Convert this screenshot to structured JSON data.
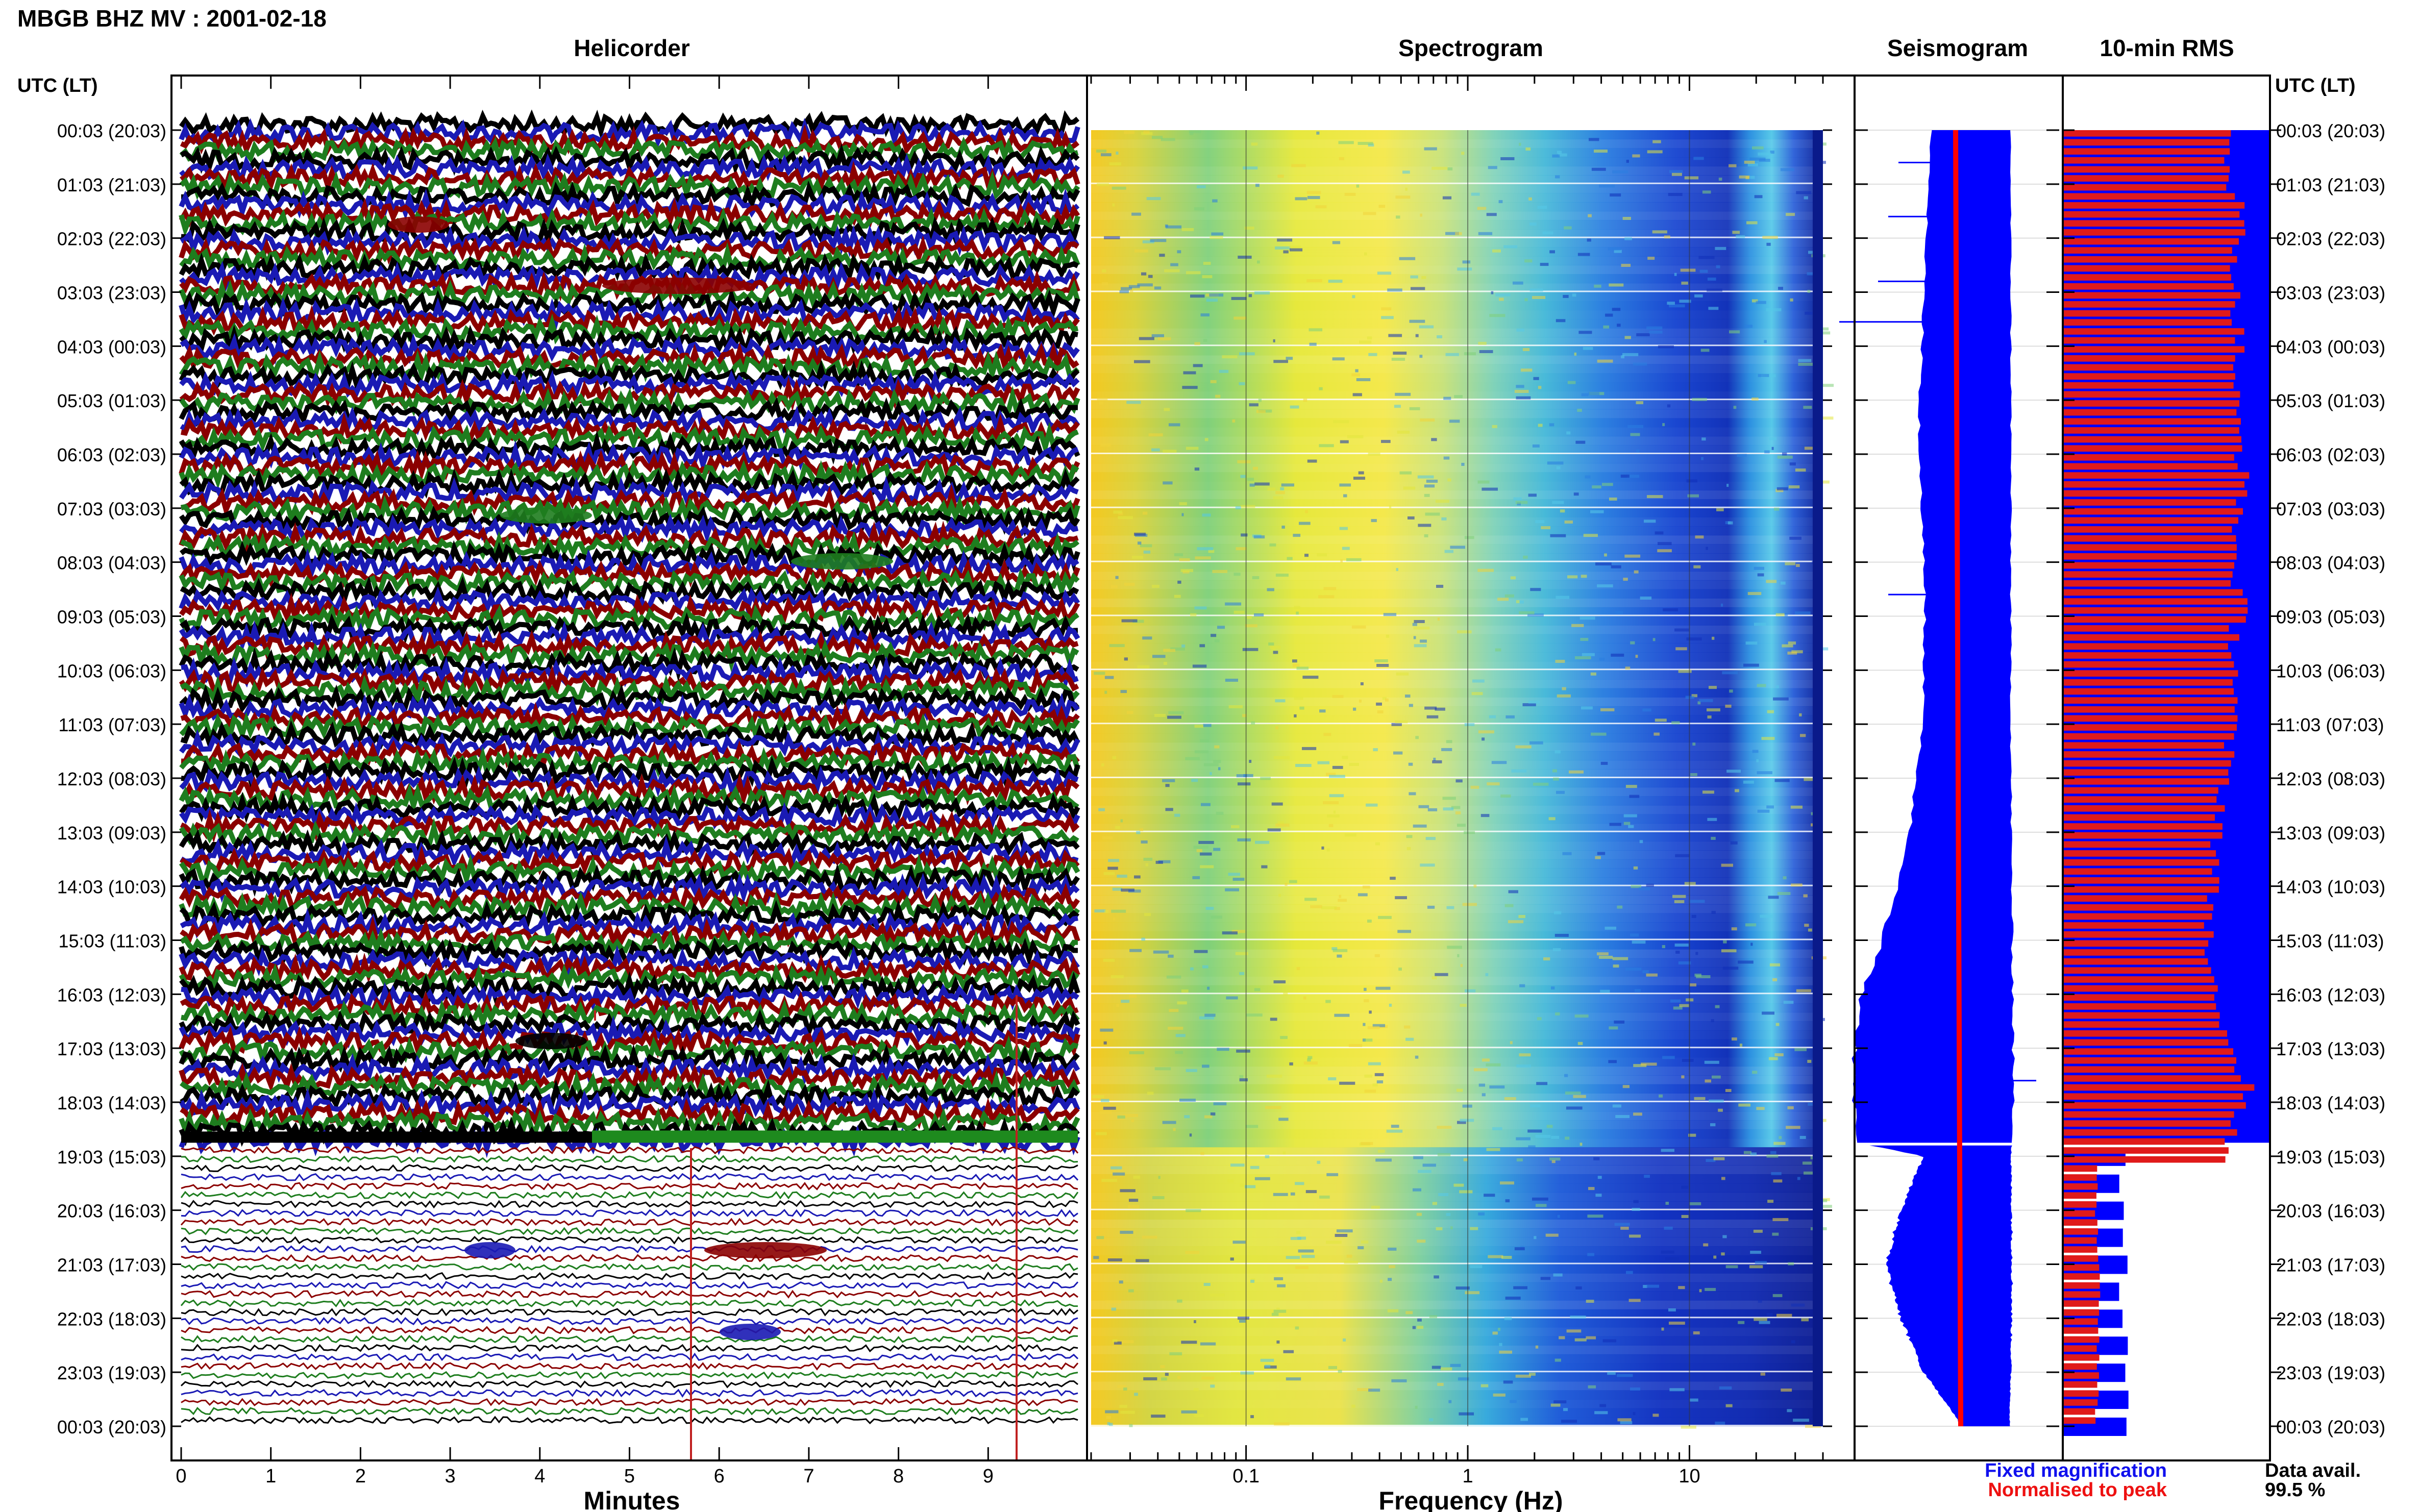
{
  "header": {
    "station_title": "MBGB BHZ MV : 2001-02-18"
  },
  "panels": {
    "helicorder": "Helicorder",
    "spectrogram": "Spectrogram",
    "seismogram": "Seismogram",
    "rms": "10-min RMS"
  },
  "axis": {
    "utc_label_left": "UTC (LT)",
    "utc_label_right": "UTC (LT)",
    "time_rows": [
      "00:03 (20:03)",
      "01:03 (21:03)",
      "02:03 (22:03)",
      "03:03 (23:03)",
      "04:03 (00:03)",
      "05:03 (01:03)",
      "06:03 (02:03)",
      "07:03 (03:03)",
      "08:03 (04:03)",
      "09:03 (05:03)",
      "10:03 (06:03)",
      "11:03 (07:03)",
      "12:03 (08:03)",
      "13:03 (09:03)",
      "14:03 (10:03)",
      "15:03 (11:03)",
      "16:03 (12:03)",
      "17:03 (13:03)",
      "18:03 (14:03)",
      "19:03 (15:03)",
      "20:03 (16:03)",
      "21:03 (17:03)",
      "22:03 (18:03)",
      "23:03 (19:03)",
      "00:03 (20:03)"
    ],
    "minutes_label": "Minutes",
    "minutes_ticks": [
      "0",
      "1",
      "2",
      "3",
      "4",
      "5",
      "6",
      "7",
      "8",
      "9"
    ],
    "frequency_label": "Frequency (Hz)",
    "frequency_ticks": [
      "0.1",
      "1",
      "10"
    ]
  },
  "legend": {
    "fixed": "Fixed magnification",
    "normalised": "Normalised to peak",
    "fixed_color": "#1010ee",
    "normalised_color": "#ee1111"
  },
  "availability": {
    "label": "Data avail.",
    "value": "99.5 %"
  },
  "colors": {
    "trace_black": "#000000",
    "trace_blue": "#1a1ab4",
    "trace_red": "#8b0000",
    "trace_green": "#1e7d1e",
    "seis_blue": "#0000ff",
    "seis_red": "#ff0000",
    "rms_red": "#e01a1a"
  },
  "chart_data": {
    "type": "heatmap",
    "title": "MBGB BHZ MV : 2001-02-18",
    "xlabel_helicorder": "Minutes",
    "xlim_minutes": [
      0,
      10
    ],
    "xlabel_spectrogram": "Frequency (Hz)",
    "xlim_frequency_hz": [
      0.02,
      40
    ],
    "x_scale_spectrogram": "log",
    "ylim_hours": [
      0,
      24
    ],
    "high_gain_until_hour": 18.75,
    "rms_normalised": [
      [
        0.0,
        0.8
      ],
      [
        0.5,
        0.82
      ],
      [
        1.0,
        0.85
      ],
      [
        1.5,
        0.86
      ],
      [
        2.0,
        0.84
      ],
      [
        2.5,
        0.83
      ],
      [
        3.0,
        0.84
      ],
      [
        3.5,
        0.85
      ],
      [
        4.0,
        0.84
      ],
      [
        4.5,
        0.83
      ],
      [
        5.0,
        0.84
      ],
      [
        5.5,
        0.86
      ],
      [
        6.0,
        0.87
      ],
      [
        6.5,
        0.86
      ],
      [
        7.0,
        0.84
      ],
      [
        7.5,
        0.83
      ],
      [
        8.0,
        0.84
      ],
      [
        8.5,
        0.86
      ],
      [
        9.0,
        0.83
      ],
      [
        9.5,
        0.84
      ],
      [
        10.0,
        0.83
      ],
      [
        10.5,
        0.82
      ],
      [
        11.0,
        0.8
      ],
      [
        11.5,
        0.79
      ],
      [
        12.0,
        0.77
      ],
      [
        12.5,
        0.76
      ],
      [
        13.0,
        0.74
      ],
      [
        13.5,
        0.73
      ],
      [
        14.0,
        0.72
      ],
      [
        14.5,
        0.71
      ],
      [
        15.0,
        0.7
      ],
      [
        15.5,
        0.72
      ],
      [
        16.0,
        0.74
      ],
      [
        16.5,
        0.81
      ],
      [
        17.0,
        0.86
      ],
      [
        17.5,
        0.9
      ],
      [
        18.0,
        0.84
      ],
      [
        18.5,
        0.8
      ],
      [
        19.0,
        0.17
      ],
      [
        19.5,
        0.16
      ],
      [
        20.0,
        0.17
      ],
      [
        20.5,
        0.17
      ],
      [
        21.0,
        0.18
      ],
      [
        21.5,
        0.17
      ],
      [
        22.0,
        0.17
      ],
      [
        22.5,
        0.17
      ],
      [
        23.0,
        0.17
      ],
      [
        23.5,
        0.16
      ],
      [
        24.0,
        0.16
      ]
    ],
    "seismogram_envelope_normalised": [
      [
        0.0,
        0.5
      ],
      [
        1.0,
        0.52
      ],
      [
        2.0,
        0.53
      ],
      [
        3.0,
        0.55
      ],
      [
        4.0,
        0.56
      ],
      [
        5.0,
        0.58
      ],
      [
        6.0,
        0.58
      ],
      [
        7.0,
        0.56
      ],
      [
        8.0,
        0.55
      ],
      [
        9.0,
        0.54
      ],
      [
        10.0,
        0.55
      ],
      [
        11.0,
        0.56
      ],
      [
        12.0,
        0.6
      ],
      [
        13.0,
        0.64
      ],
      [
        14.0,
        0.72
      ],
      [
        15.0,
        0.82
      ],
      [
        16.0,
        0.96
      ],
      [
        17.0,
        1.0
      ],
      [
        18.0,
        1.0
      ],
      [
        18.75,
        1.0
      ],
      [
        19.0,
        0.55
      ],
      [
        20.0,
        0.7
      ],
      [
        21.0,
        0.8
      ],
      [
        22.0,
        0.7
      ],
      [
        23.0,
        0.55
      ],
      [
        24.0,
        0.3
      ]
    ]
  }
}
